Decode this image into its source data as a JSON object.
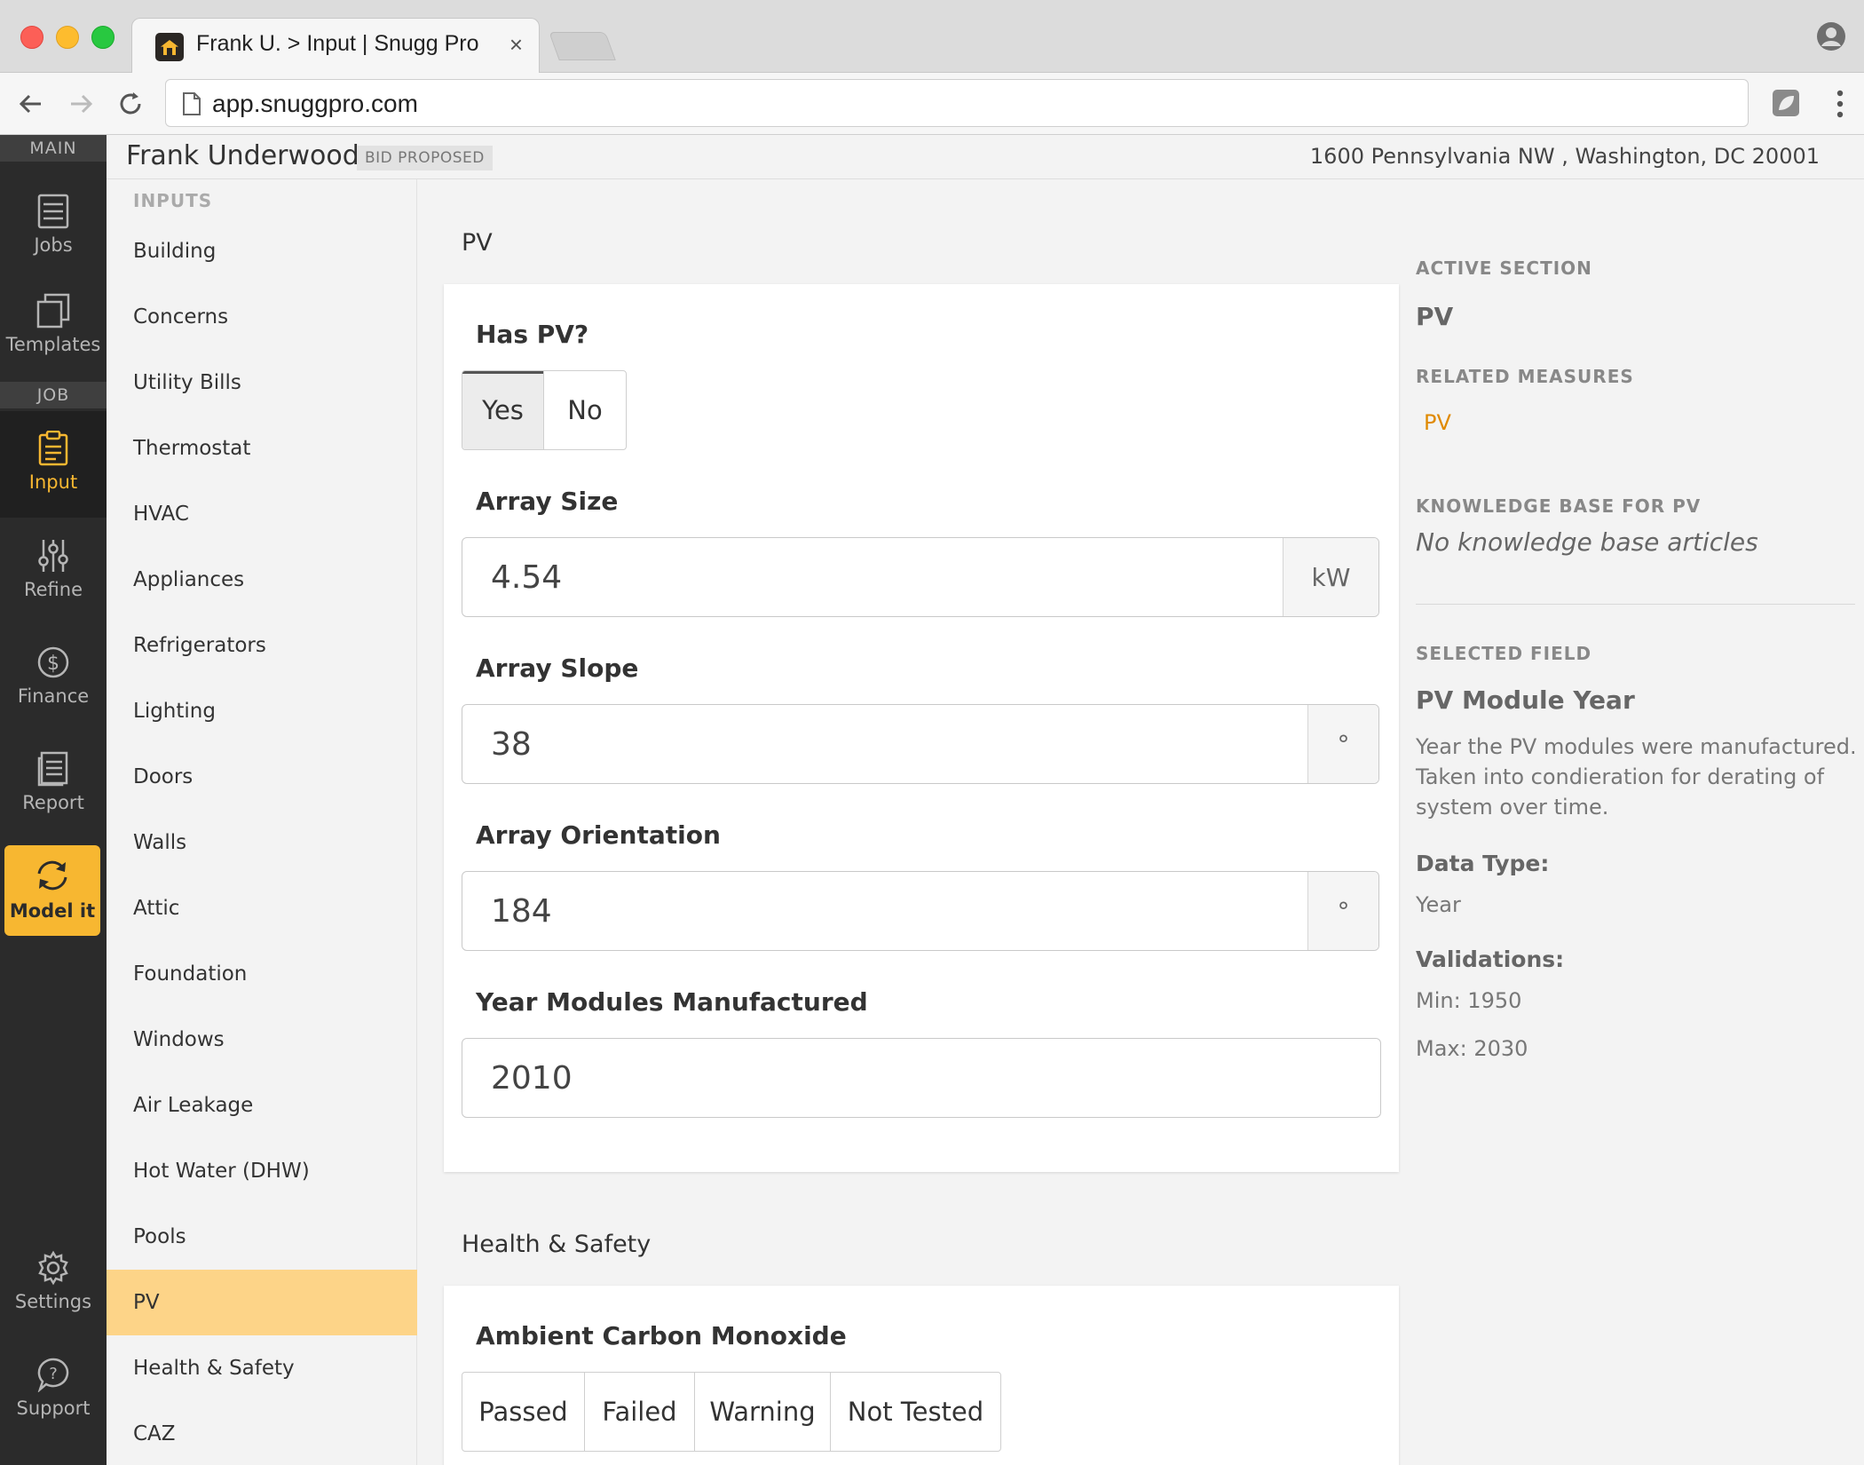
{
  "browser": {
    "tab_title": "Frank U. > Input | Snugg Pro",
    "tab_close": "×",
    "url": "app.snuggpro.com"
  },
  "rail": {
    "section_main": "MAIN",
    "section_job": "JOB",
    "items": [
      {
        "label": "Jobs"
      },
      {
        "label": "Templates"
      },
      {
        "label": "Input"
      },
      {
        "label": "Refine"
      },
      {
        "label": "Finance"
      },
      {
        "label": "Report"
      },
      {
        "label": "Model it"
      },
      {
        "label": "Settings"
      },
      {
        "label": "Support"
      }
    ]
  },
  "header": {
    "name": "Frank Underwood",
    "badge": "BID PROPOSED",
    "address": "1600 Pennsylvania NW , Washington, DC 20001"
  },
  "inputs_nav": {
    "heading": "INPUTS",
    "items": [
      "Building",
      "Concerns",
      "Utility Bills",
      "Thermostat",
      "HVAC",
      "Appliances",
      "Refrigerators",
      "Lighting",
      "Doors",
      "Walls",
      "Attic",
      "Foundation",
      "Windows",
      "Air Leakage",
      "Hot Water (DHW)",
      "Pools",
      "PV",
      "Health & Safety",
      "CAZ"
    ],
    "selected": "PV"
  },
  "pv": {
    "title": "PV",
    "has_pv_label": "Has PV?",
    "has_pv_options": [
      "Yes",
      "No"
    ],
    "has_pv_selected": "Yes",
    "array_size_label": "Array Size",
    "array_size_value": "4.54",
    "array_size_unit": "kW",
    "array_slope_label": "Array Slope",
    "array_slope_value": "38",
    "array_slope_unit": "°",
    "array_orientation_label": "Array Orientation",
    "array_orientation_value": "184",
    "array_orientation_unit": "°",
    "year_label": "Year Modules Manufactured",
    "year_value": "2010"
  },
  "health": {
    "title": "Health & Safety",
    "co_label": "Ambient Carbon Monoxide",
    "co_options": [
      "Passed",
      "Failed",
      "Warning",
      "Not Tested"
    ]
  },
  "side": {
    "active_section_caption": "ACTIVE SECTION",
    "active_section": "PV",
    "related_caption": "RELATED MEASURES",
    "related_link": "PV",
    "kb_caption": "KNOWLEDGE BASE FOR PV",
    "kb_empty": "No knowledge base articles",
    "selected_caption": "SELECTED FIELD",
    "selected_field": "PV Module Year",
    "desc_line1": "Year the PV modules were manufactured.",
    "desc_line2": "Taken into condieration for derating of",
    "desc_line3": "system over time.",
    "data_type_label": "Data Type:",
    "data_type": "Year",
    "validations_label": "Validations:",
    "min": "Min: 1950",
    "max": "Max: 2030"
  },
  "colors": {
    "accent": "#f7b731",
    "selected_nav": "#fdd488",
    "rail_bg": "#2b2b2b",
    "link": "#e08a00"
  }
}
